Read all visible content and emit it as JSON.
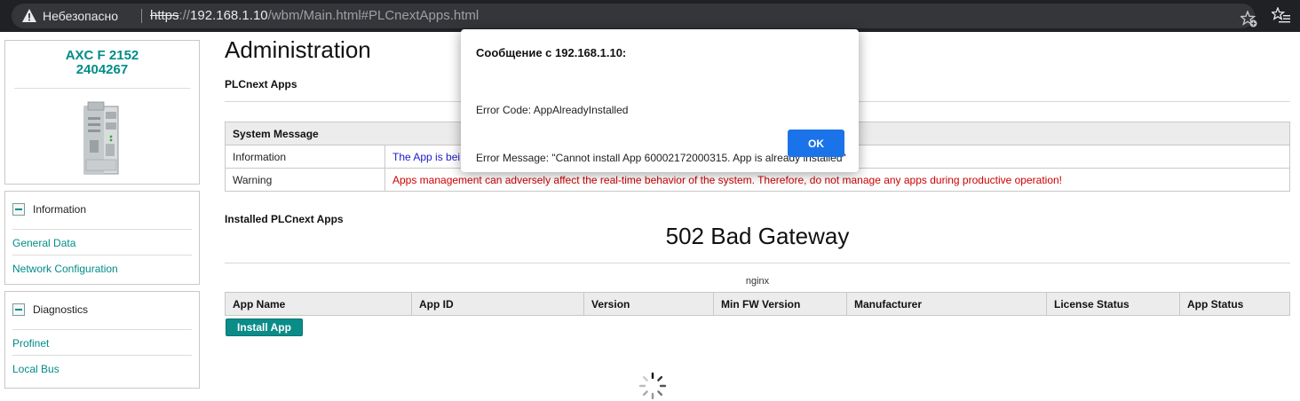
{
  "browser": {
    "security_label": "Небезопасно",
    "url_scheme": "https",
    "url_rest_prefix": "://",
    "url_host": "192.168.1.10",
    "url_path": "/wbm/Main.html#PLCnextApps.html"
  },
  "sidebar": {
    "device_name_line1": "AXC F 2152",
    "device_name_line2": "2404267",
    "groups": [
      {
        "title": "Information",
        "items": [
          "General Data",
          "Network Configuration"
        ]
      },
      {
        "title": "Diagnostics",
        "items": [
          "Profinet",
          "Local Bus"
        ]
      }
    ]
  },
  "main": {
    "title": "Administration",
    "section": "PLCnext Apps",
    "system_message": {
      "header": "System Message",
      "rows": [
        {
          "key": "Information",
          "value": "The App is bei"
        },
        {
          "key": "Warning",
          "value": "Apps management can adversely affect the real-time behavior of the system. Therefore, do not manage any apps during productive operation!"
        }
      ]
    },
    "installed_label": "Installed PLCnext Apps",
    "gateway_text": "502 Bad Gateway",
    "nginx_text": "nginx",
    "apps_table": {
      "columns": [
        "App Name",
        "App ID",
        "Version",
        "Min FW Version",
        "Manufacturer",
        "License Status",
        "App Status"
      ]
    },
    "install_button": "Install App"
  },
  "dialog": {
    "title": "Сообщение с 192.168.1.10:",
    "message_line1": "Error Code: AppAlreadyInstalled",
    "message_line2": "Error Message: \"Cannot install App 60002172000315. App is already installed\"",
    "ok_label": "OK"
  },
  "colors": {
    "accent": "#008c88",
    "ok_button": "#1a73e8",
    "warning_text": "#cc0000",
    "info_text": "#1a1acc"
  }
}
